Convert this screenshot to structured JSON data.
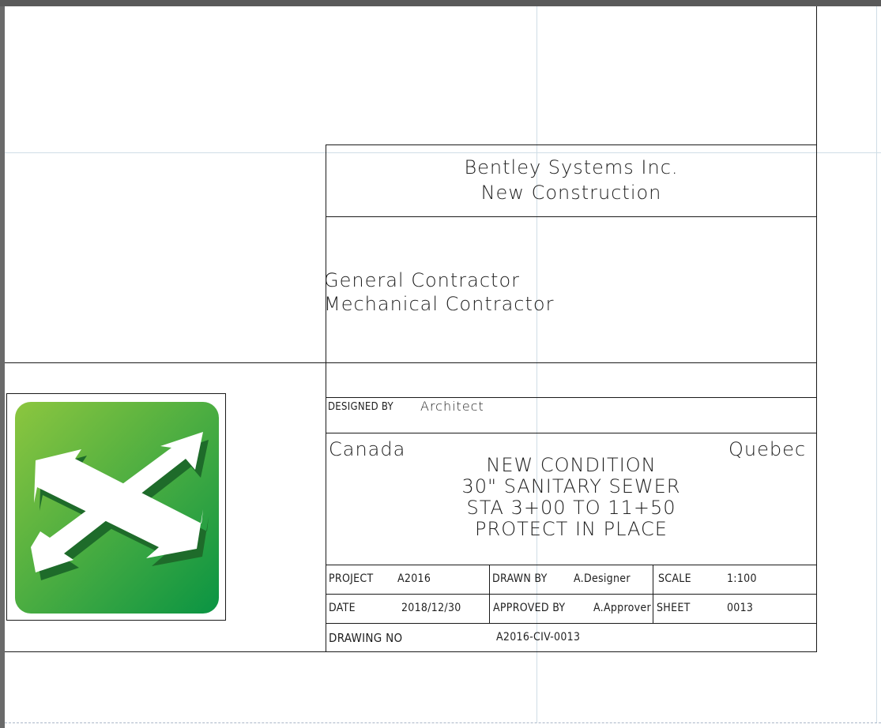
{
  "company": {
    "line1": "Bentley Systems Inc.",
    "line2": "New Construction"
  },
  "contractors": {
    "line1": "General Contractor",
    "line2": "Mechanical Contractor"
  },
  "designed_by": {
    "label": "DESIGNED BY",
    "value": "Architect"
  },
  "location": {
    "country": "Canada",
    "province": "Quebec"
  },
  "description": {
    "line1": "NEW CONDITION",
    "line2": "30\" SANITARY SEWER",
    "line3": "STA 3+00 TO 11+50",
    "line4": "PROTECT IN PLACE"
  },
  "project": {
    "label": "PROJECT",
    "value": "A2016"
  },
  "drawn_by": {
    "label": "DRAWN BY",
    "value": "A.Designer"
  },
  "scale": {
    "label": "SCALE",
    "value": "1:100"
  },
  "date": {
    "label": "DATE",
    "value": "2018/12/30"
  },
  "approved_by": {
    "label": "APPROVED BY",
    "value": "A.Approver"
  },
  "sheet": {
    "label": "SHEET",
    "value": "0013"
  },
  "drawing_no": {
    "label": "DRAWING NO",
    "value": "A2016-CIV-0013"
  },
  "logo": {
    "icon": "four-arrows-logo-icon",
    "gradient_start": "#8cc63f",
    "gradient_end": "#0a9443",
    "arrow_color": "#ffffff",
    "shadow_color": "#1e6b2a"
  }
}
